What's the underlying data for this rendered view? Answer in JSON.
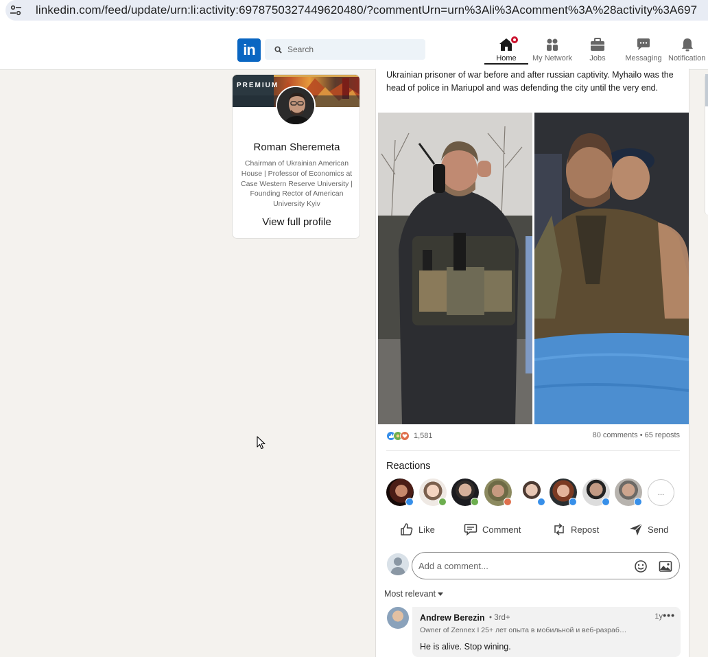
{
  "browser": {
    "url": "linkedin.com/feed/update/urn:li:activity:6978750327449620480/?commentUrn=urn%3Ali%3Acomment%3A%28activity%3A697"
  },
  "nav": {
    "logo": "in",
    "search_placeholder": "Search",
    "items": [
      {
        "label": "Home",
        "icon": "home-icon",
        "active": true
      },
      {
        "label": "My Network",
        "icon": "network-icon"
      },
      {
        "label": "Jobs",
        "icon": "briefcase-icon"
      },
      {
        "label": "Messaging",
        "icon": "messaging-icon"
      },
      {
        "label": "Notification",
        "icon": "bell-icon"
      }
    ]
  },
  "profile": {
    "badge": "PREMIUM",
    "name": "Roman Sheremeta",
    "headline": "Chairman of Ukrainian American House | Professor of Economics at Case Western Reserve University | Founding Rector of American University Kyiv",
    "view_label": "View full profile"
  },
  "post": {
    "text": "Ukrainian prisoner of war before and after russian captivity. Myhailo was the head of police in Mariupol and was defending the city until the very end.",
    "reaction_count": "1,581",
    "comments_reposts": "80 comments • 65 reposts",
    "reactions_title": "Reactions",
    "reactions_more": "...",
    "actions": {
      "like": "Like",
      "comment": "Comment",
      "repost": "Repost",
      "send": "Send"
    },
    "comment_placeholder": "Add a comment...",
    "sort_label": "Most relevant"
  },
  "comment": {
    "author": "Andrew Berezin",
    "degree": "• 3rd+",
    "time": "1y",
    "more": "•••",
    "subtitle": "Owner of Zennex I 25+ лет опыта в мобильной и веб-разраб…",
    "text": "He is alive. Stop wining."
  },
  "colors": {
    "brand": "#0a66c2",
    "badge": "#cb112d",
    "page_bg": "#f4f2ee",
    "like_blue": "#378fe9",
    "love_red": "#df704d"
  }
}
